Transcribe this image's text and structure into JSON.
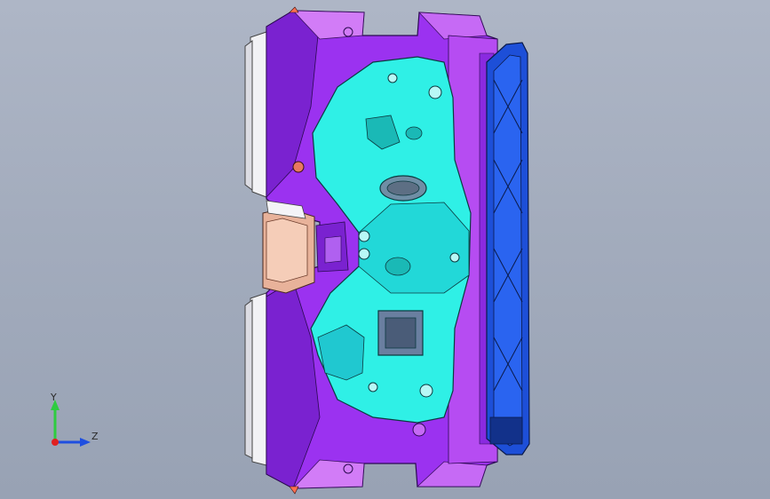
{
  "viewport": {
    "background_top": "#aeb6c6",
    "background_bottom": "#98a2b4"
  },
  "model": {
    "description_colors": {
      "body": "#9b32f0",
      "body_dark": "#6a1fb8",
      "body_light": "#c76cf5",
      "insert": "#2ff0e6",
      "insert_dark": "#1ab9b6",
      "plate": "#1d4fd8",
      "plate_dark": "#12318a",
      "copper": "#e8b29a",
      "frame": "#e9e9ee"
    }
  },
  "triad": {
    "y_label": "Y",
    "z_label": "Z",
    "y_color": "#2ecc40",
    "z_color": "#1f4fe0",
    "origin_color": "#e02020"
  }
}
